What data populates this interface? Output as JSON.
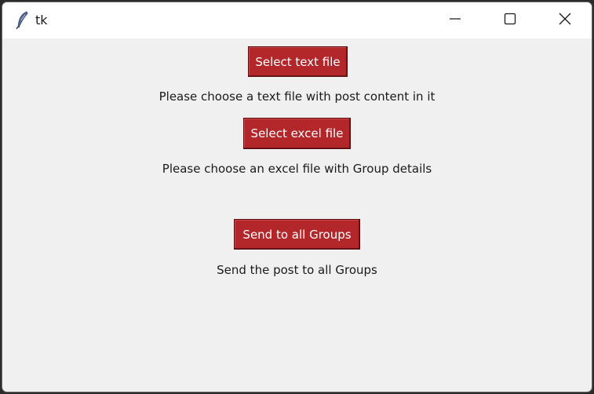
{
  "window": {
    "title": "tk",
    "icon": "feather-icon"
  },
  "controls": {
    "minimize_icon": "minimize-icon",
    "maximize_icon": "maximize-icon",
    "close_icon": "close-icon"
  },
  "main": {
    "select_text_button": "Select text file",
    "select_text_hint": "Please choose a text file with post content in it",
    "select_excel_button": "Select excel file",
    "select_excel_hint": "Please choose an excel file with Group details",
    "send_button": "Send to all Groups",
    "send_hint": "Send the post to all Groups"
  },
  "colors": {
    "button_bg": "#b3262a",
    "button_text": "#ffffff",
    "window_bg": "#f0f0f0"
  }
}
